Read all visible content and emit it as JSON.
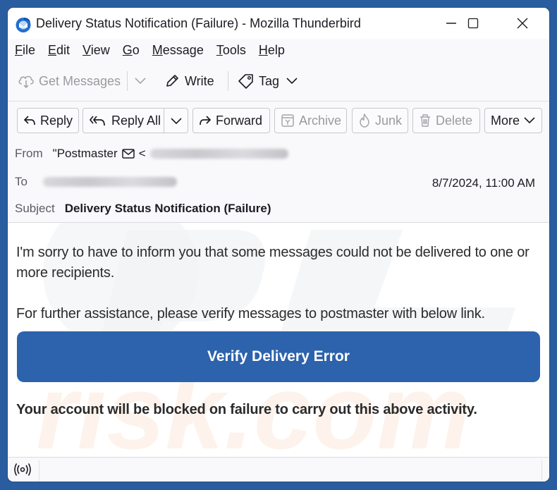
{
  "window": {
    "title": "Delivery Status Notification (Failure) - Mozilla Thunderbird",
    "controls": {
      "minimize": "minimize-icon",
      "maximize": "maximize-icon",
      "close": "close-icon"
    }
  },
  "menubar": {
    "items": [
      {
        "accel": "F",
        "rest": "ile"
      },
      {
        "accel": "E",
        "rest": "dit"
      },
      {
        "accel": "V",
        "rest": "iew"
      },
      {
        "accel": "G",
        "rest": "o"
      },
      {
        "accel": "M",
        "rest": "essage"
      },
      {
        "accel": "T",
        "rest": "ools"
      },
      {
        "accel": "H",
        "rest": "elp"
      }
    ]
  },
  "toolbar": {
    "get_messages": "Get Messages",
    "write": "Write",
    "tag": "Tag"
  },
  "message_actions": {
    "reply": "Reply",
    "reply_all": "Reply All",
    "forward": "Forward",
    "archive": "Archive",
    "junk": "Junk",
    "delete": "Delete",
    "more": "More"
  },
  "header": {
    "from_label": "From",
    "from_name": "\"Postmaster",
    "from_lt": "<",
    "to_label": "To",
    "subject_label": "Subject",
    "subject": "Delivery Status Notification (Failure)",
    "date": "8/7/2024, 11:00 AM"
  },
  "body": {
    "paragraph1": "I'm sorry to have to inform you that some messages could not be delivered to one or more recipients.",
    "paragraph2": "For further assistance, please verify messages to postmaster with below link.",
    "cta_label": "Verify Delivery Error",
    "warning": "Your account will be blocked on failure to carry out this above activity.",
    "cta_color": "#2d62ac"
  },
  "statusbar": {
    "icon": "online-status-icon"
  }
}
